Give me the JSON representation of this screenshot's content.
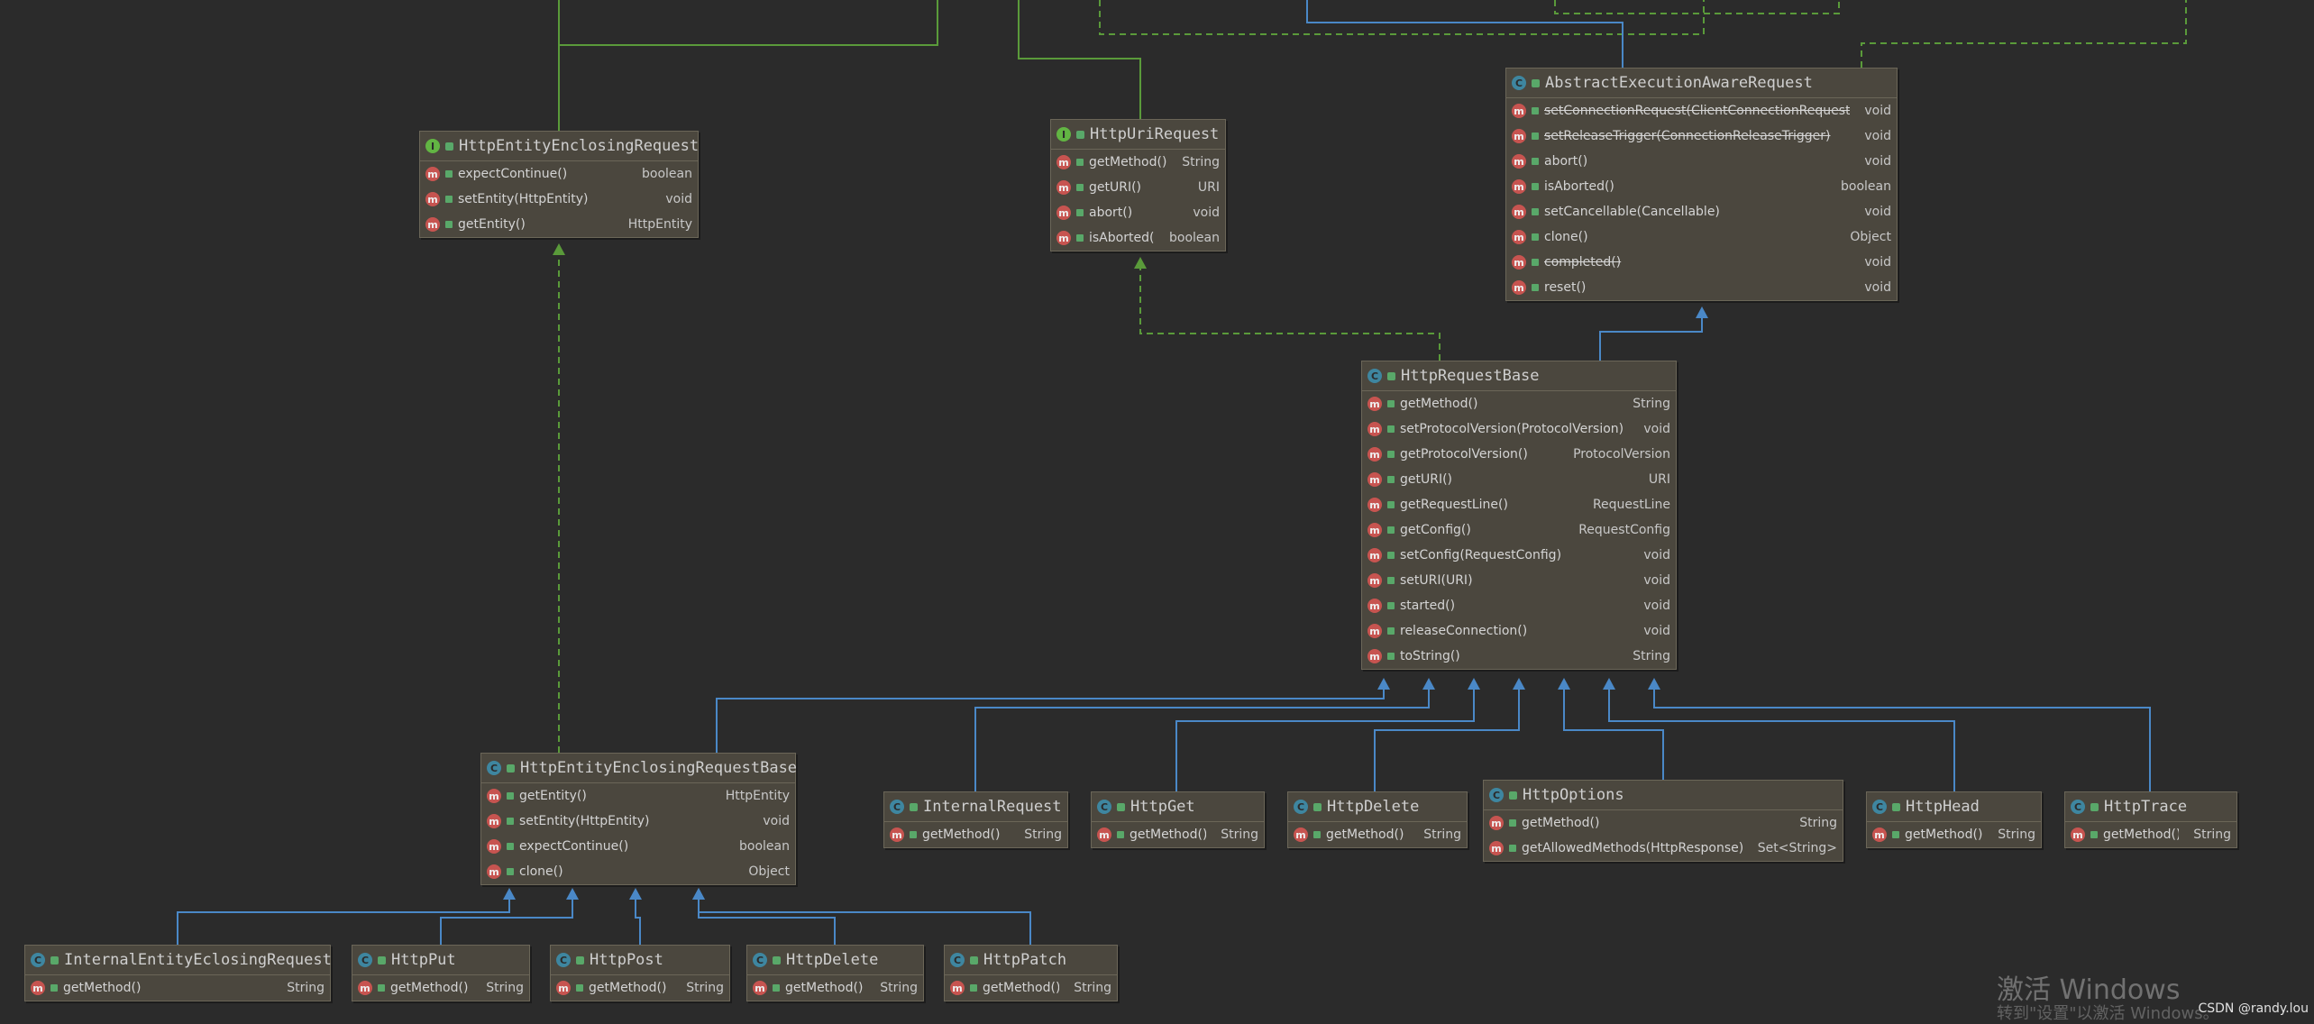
{
  "nodes": {
    "entity_enclosing_request": {
      "title": "HttpEntityEnclosingRequest",
      "kind": "I",
      "methods": [
        {
          "name": "expectContinue()",
          "type": "boolean"
        },
        {
          "name": "setEntity(HttpEntity)",
          "type": "void"
        },
        {
          "name": "getEntity()",
          "type": "HttpEntity"
        }
      ]
    },
    "uri_request": {
      "title": "HttpUriRequest",
      "kind": "I",
      "methods": [
        {
          "name": "getMethod()",
          "type": "String"
        },
        {
          "name": "getURI()",
          "type": "URI"
        },
        {
          "name": "abort()",
          "type": "void"
        },
        {
          "name": "isAborted()",
          "type": "boolean"
        }
      ]
    },
    "abstract_execution": {
      "title": "AbstractExecutionAwareRequest",
      "kind": "C",
      "methods": [
        {
          "name": "setConnectionRequest(ClientConnectionRequest)",
          "type": "void",
          "deprecated": true
        },
        {
          "name": "setReleaseTrigger(ConnectionReleaseTrigger)",
          "type": "void",
          "deprecated": true
        },
        {
          "name": "abort()",
          "type": "void"
        },
        {
          "name": "isAborted()",
          "type": "boolean"
        },
        {
          "name": "setCancellable(Cancellable)",
          "type": "void"
        },
        {
          "name": "clone()",
          "type": "Object"
        },
        {
          "name": "completed()",
          "type": "void",
          "deprecated": true
        },
        {
          "name": "reset()",
          "type": "void"
        }
      ]
    },
    "request_base": {
      "title": "HttpRequestBase",
      "kind": "C",
      "methods": [
        {
          "name": "getMethod()",
          "type": "String"
        },
        {
          "name": "setProtocolVersion(ProtocolVersion)",
          "type": "void"
        },
        {
          "name": "getProtocolVersion()",
          "type": "ProtocolVersion"
        },
        {
          "name": "getURI()",
          "type": "URI"
        },
        {
          "name": "getRequestLine()",
          "type": "RequestLine"
        },
        {
          "name": "getConfig()",
          "type": "RequestConfig"
        },
        {
          "name": "setConfig(RequestConfig)",
          "type": "void"
        },
        {
          "name": "setURI(URI)",
          "type": "void"
        },
        {
          "name": "started()",
          "type": "void"
        },
        {
          "name": "releaseConnection()",
          "type": "void"
        },
        {
          "name": "toString()",
          "type": "String"
        }
      ]
    },
    "entity_enclosing_base": {
      "title": "HttpEntityEnclosingRequestBase",
      "kind": "C",
      "methods": [
        {
          "name": "getEntity()",
          "type": "HttpEntity"
        },
        {
          "name": "setEntity(HttpEntity)",
          "type": "void"
        },
        {
          "name": "expectContinue()",
          "type": "boolean"
        },
        {
          "name": "clone()",
          "type": "Object"
        }
      ]
    },
    "internal_request": {
      "title": "InternalRequest",
      "kind": "C",
      "methods": [
        {
          "name": "getMethod()",
          "type": "String"
        }
      ]
    },
    "http_get": {
      "title": "HttpGet",
      "kind": "C",
      "methods": [
        {
          "name": "getMethod()",
          "type": "String"
        }
      ]
    },
    "http_delete_top": {
      "title": "HttpDelete",
      "kind": "C",
      "methods": [
        {
          "name": "getMethod()",
          "type": "String"
        }
      ]
    },
    "http_options": {
      "title": "HttpOptions",
      "kind": "C",
      "methods": [
        {
          "name": "getMethod()",
          "type": "String"
        },
        {
          "name": "getAllowedMethods(HttpResponse)",
          "type": "Set<String>"
        }
      ]
    },
    "http_head": {
      "title": "HttpHead",
      "kind": "C",
      "methods": [
        {
          "name": "getMethod()",
          "type": "String"
        }
      ]
    },
    "http_trace": {
      "title": "HttpTrace",
      "kind": "C",
      "methods": [
        {
          "name": "getMethod()",
          "type": "String"
        }
      ]
    },
    "internal_entity": {
      "title": "InternalEntityEclosingRequest",
      "kind": "C",
      "methods": [
        {
          "name": "getMethod()",
          "type": "String"
        }
      ]
    },
    "http_put": {
      "title": "HttpPut",
      "kind": "C",
      "methods": [
        {
          "name": "getMethod()",
          "type": "String"
        }
      ]
    },
    "http_post": {
      "title": "HttpPost",
      "kind": "C",
      "methods": [
        {
          "name": "getMethod()",
          "type": "String"
        }
      ]
    },
    "http_delete_bottom": {
      "title": "HttpDelete",
      "kind": "C",
      "methods": [
        {
          "name": "getMethod()",
          "type": "String"
        }
      ]
    },
    "http_patch": {
      "title": "HttpPatch",
      "kind": "C",
      "methods": [
        {
          "name": "getMethod()",
          "type": "String"
        }
      ]
    }
  },
  "watermark": {
    "line1": "激活 Windows",
    "line2": "转到\"设置\"以激活 Windows。"
  },
  "credit": "CSDN @randy.lou",
  "colors": {
    "extends": "#4a88c7",
    "implements": "#5a9a3a",
    "background": "#2b2b2b",
    "node": "#4b473e"
  }
}
